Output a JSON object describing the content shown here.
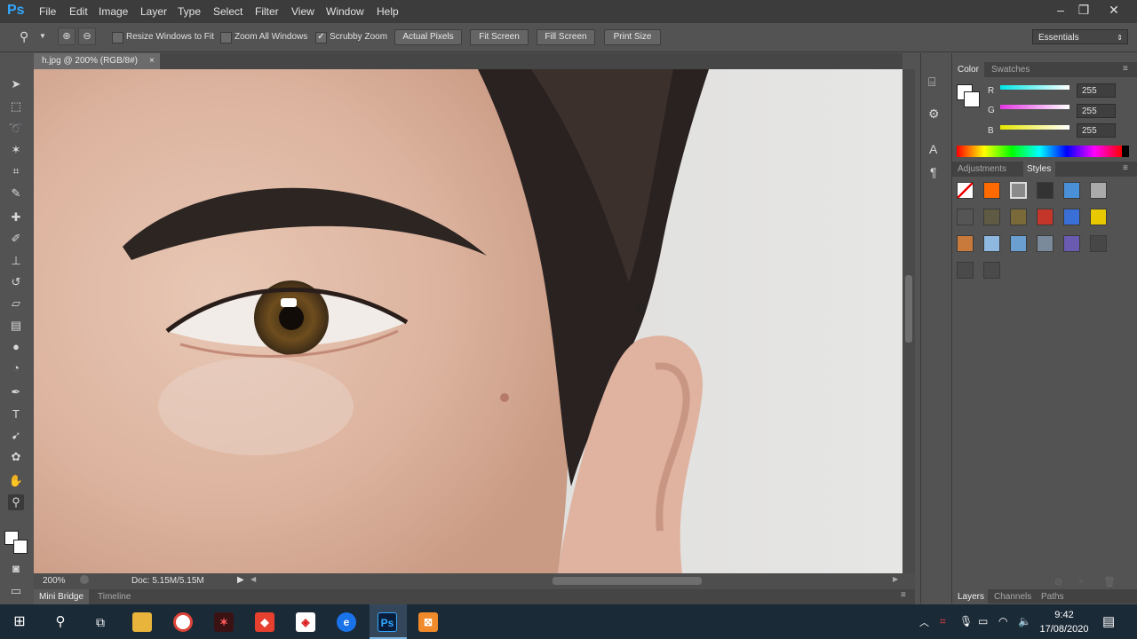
{
  "app": {
    "logo": "Ps",
    "menu": [
      "File",
      "Edit",
      "Image",
      "Layer",
      "Type",
      "Select",
      "Filter",
      "View",
      "Window",
      "Help"
    ],
    "window_controls": [
      "minimize-icon",
      "restore-icon",
      "close-icon"
    ]
  },
  "options_bar": {
    "zoom_in_icon": "zoom-in-icon",
    "zoom_out_icon": "zoom-out-icon",
    "checkboxes": [
      {
        "label": "Resize Windows to Fit",
        "checked": false
      },
      {
        "label": "Zoom All Windows",
        "checked": false
      },
      {
        "label": "Scrubby Zoom",
        "checked": true
      }
    ],
    "buttons": [
      "Actual Pixels",
      "Fit Screen",
      "Fill Screen",
      "Print Size"
    ],
    "workspace": "Essentials"
  },
  "document": {
    "tab_title": "h.jpg @ 200% (RGB/8#)",
    "tab_close": "×",
    "zoom": "200%",
    "doc_info": "Doc: 5.15M/5.15M"
  },
  "bottom_tabs": [
    "Mini Bridge",
    "Timeline"
  ],
  "color_panel": {
    "tabs": [
      "Color",
      "Swatches"
    ],
    "channels": [
      {
        "label": "R",
        "value": "255",
        "color": "#00e5e5"
      },
      {
        "label": "G",
        "value": "255",
        "color": "#e535e5"
      },
      {
        "label": "B",
        "value": "255",
        "color": "#e5e500"
      }
    ]
  },
  "styles_panel": {
    "tabs": [
      "Adjustments",
      "Styles"
    ],
    "swatches": [
      "#ffffff",
      "#ff6a00",
      "#8a8a8a",
      "#333333",
      "#4a90d9",
      "#aaaaaa",
      "#555555",
      "#5e5a44",
      "#7a6a3a",
      "#c4352a",
      "#3a6fd8",
      "#e8c800",
      "#c87a3c",
      "#8fb8e0",
      "#6a9fd0",
      "#7a8a9a",
      "#6a5ab0",
      "#474747",
      "#4a4a4a",
      "#4a4a4a"
    ]
  },
  "layers_panel": {
    "tabs": [
      "Layers",
      "Channels",
      "Paths"
    ]
  },
  "taskbar": {
    "time": "9:42",
    "date": "17/08/2020",
    "apps": [
      "Ps"
    ]
  }
}
